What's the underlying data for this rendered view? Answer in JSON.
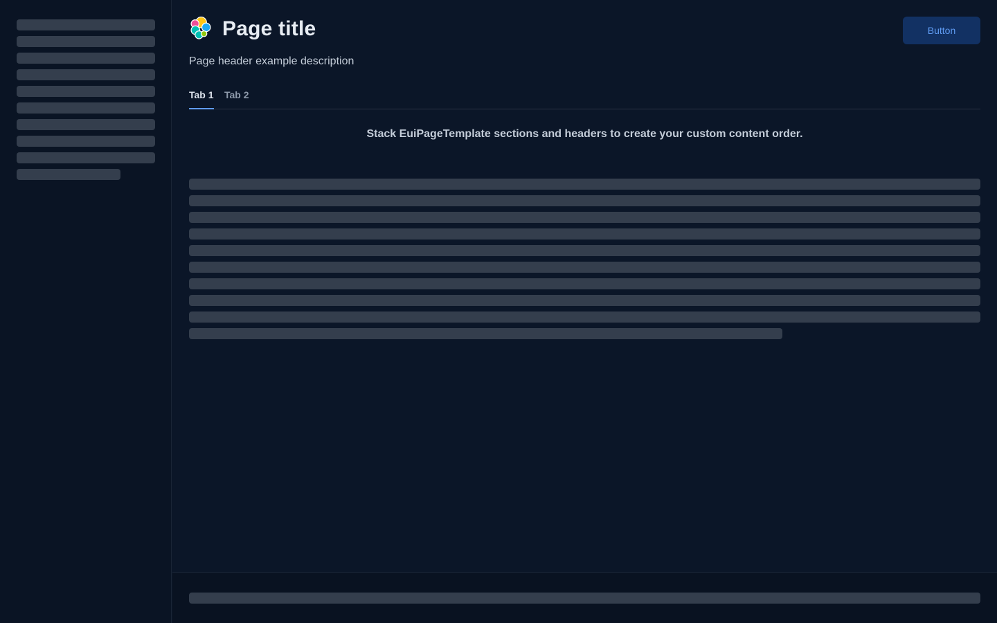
{
  "header": {
    "title": "Page title",
    "description": "Page header example description",
    "button_label": "Button"
  },
  "tabs": [
    {
      "label": "Tab 1",
      "selected": true
    },
    {
      "label": "Tab 2",
      "selected": false
    }
  ],
  "content": {
    "intro": "Stack EuiPageTemplate sections and headers to create your custom content order."
  },
  "colors": {
    "background": "#0b1628",
    "sidebar": "#0a1424",
    "skeleton": "#343e4d",
    "accent": "#5f9bf2",
    "button_bg": "#123163"
  },
  "icons": {
    "logo": "elastic-logo-icon"
  }
}
